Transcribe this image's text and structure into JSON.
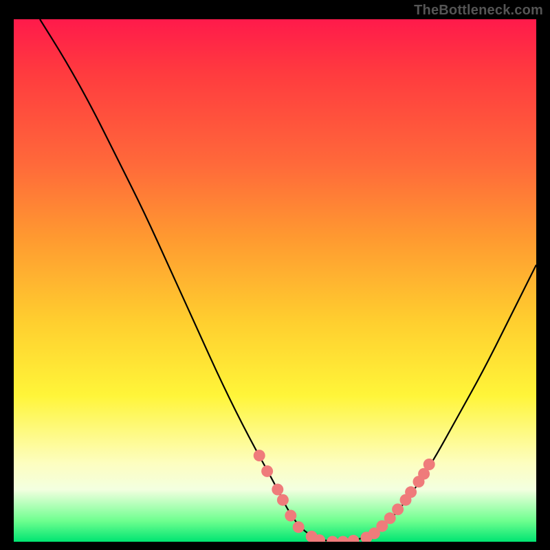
{
  "watermark": {
    "text": "TheBottleneck.com"
  },
  "colors": {
    "background": "#000000",
    "gradient_top": "#ff1a4b",
    "gradient_bottom": "#00e472",
    "curve": "#000000",
    "dots": "#ef7b7b"
  },
  "chart_data": {
    "type": "line",
    "title": "",
    "xlabel": "",
    "ylabel": "",
    "xlim": [
      0,
      100
    ],
    "ylim": [
      0,
      100
    ],
    "grid": false,
    "legend": false,
    "series": [
      {
        "name": "bottleneck-curve",
        "x": [
          5,
          10,
          15,
          20,
          25,
          30,
          35,
          40,
          45,
          50,
          53,
          56,
          60,
          64,
          68,
          72,
          76,
          80,
          85,
          90,
          95,
          100
        ],
        "values": [
          100,
          92,
          83,
          73,
          63,
          52,
          41,
          30,
          20,
          11,
          5,
          1.5,
          0,
          0,
          1,
          4,
          9,
          15,
          24,
          33,
          43,
          53
        ]
      }
    ],
    "markers": {
      "name": "highlighted-points",
      "color": "#ef7b7b",
      "points": [
        {
          "x": 47.0,
          "y": 16.5
        },
        {
          "x": 48.5,
          "y": 13.5
        },
        {
          "x": 50.5,
          "y": 10.0
        },
        {
          "x": 51.5,
          "y": 8.0
        },
        {
          "x": 53.0,
          "y": 5.0
        },
        {
          "x": 54.5,
          "y": 2.8
        },
        {
          "x": 57.0,
          "y": 1.0
        },
        {
          "x": 58.5,
          "y": 0.3
        },
        {
          "x": 61.0,
          "y": 0.0
        },
        {
          "x": 63.0,
          "y": 0.0
        },
        {
          "x": 65.0,
          "y": 0.2
        },
        {
          "x": 67.5,
          "y": 0.8
        },
        {
          "x": 69.0,
          "y": 1.6
        },
        {
          "x": 70.5,
          "y": 3.0
        },
        {
          "x": 72.0,
          "y": 4.5
        },
        {
          "x": 73.5,
          "y": 6.2
        },
        {
          "x": 75.0,
          "y": 8.0
        },
        {
          "x": 76.0,
          "y": 9.5
        },
        {
          "x": 77.5,
          "y": 11.5
        },
        {
          "x": 78.5,
          "y": 13.0
        },
        {
          "x": 79.5,
          "y": 14.8
        }
      ]
    }
  }
}
